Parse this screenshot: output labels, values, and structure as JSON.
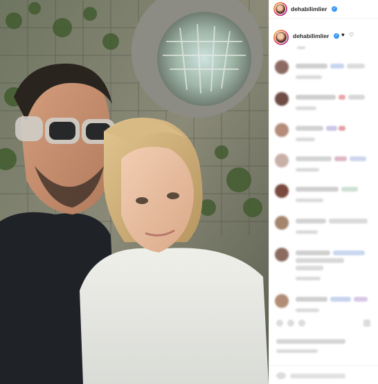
{
  "post": {
    "author": {
      "username": "dehabilimlier"
    },
    "caption": {
      "username": "dehabilimlier",
      "hearts": [
        "♥",
        "♡"
      ]
    },
    "icons": {
      "verified": "verified-badge-icon"
    },
    "colors": {
      "verified": "#3897f0",
      "username": "#262626"
    }
  }
}
